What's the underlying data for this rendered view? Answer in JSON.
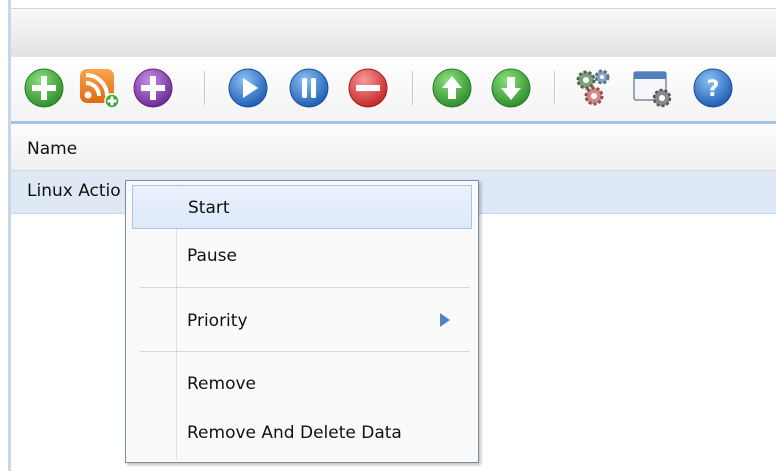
{
  "toolbar": {
    "buttons": [
      {
        "name": "add-torrent",
        "icon": "add-icon",
        "color": "#3aa638"
      },
      {
        "name": "add-rss",
        "icon": "rss-icon",
        "color": "#f07d1b"
      },
      {
        "name": "create-torrent",
        "icon": "create-icon",
        "color": "#8a3fb0"
      },
      {
        "name": "start",
        "icon": "play-icon",
        "color": "#2f73c8"
      },
      {
        "name": "pause",
        "icon": "pause-icon",
        "color": "#2f73c8"
      },
      {
        "name": "remove",
        "icon": "remove-icon",
        "color": "#d83c3c"
      },
      {
        "name": "move-up",
        "icon": "arrow-up-icon",
        "color": "#3aa638"
      },
      {
        "name": "move-down",
        "icon": "arrow-down-icon",
        "color": "#3aa638"
      },
      {
        "name": "preferences",
        "icon": "gears-icon",
        "color": "#6e8a6e"
      },
      {
        "name": "settings",
        "icon": "window-settings-icon",
        "color": "#6f7f94"
      },
      {
        "name": "help",
        "icon": "help-icon",
        "color": "#2f73c8"
      }
    ]
  },
  "list": {
    "header_name": "Name",
    "rows": [
      {
        "name": "Linux Actio"
      }
    ]
  },
  "context_menu": {
    "items": {
      "start": "Start",
      "pause": "Pause",
      "priority": "Priority",
      "remove": "Remove",
      "remove_delete": "Remove And Delete Data"
    }
  },
  "colors": {
    "accent": "#a9c3e6",
    "row_selected": "#dfe9f6",
    "menu_hover": "#dce9fa"
  }
}
